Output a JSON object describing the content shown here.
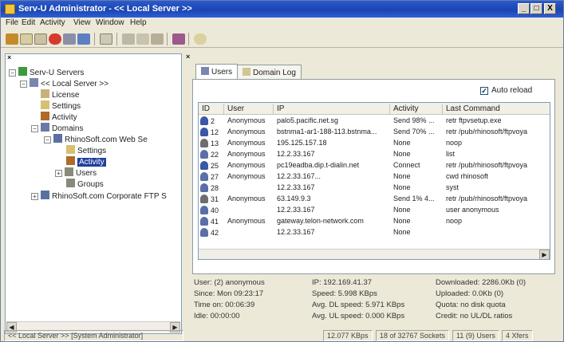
{
  "window": {
    "title": "Serv-U Administrator - << Local Server >>",
    "controls": [
      "_",
      "□",
      "X"
    ]
  },
  "menu": [
    "File",
    "Edit",
    "Activity",
    "View",
    "Window",
    "Help"
  ],
  "tree": {
    "root": "Serv-U Servers",
    "local_server": "<< Local Server >>",
    "license": "License",
    "settings": "Settings",
    "activity": "Activity",
    "domains": "Domains",
    "domain": "RhinoSoft.com Web Se",
    "domain_settings": "Settings",
    "domain_activity": "Activity",
    "users": "Users",
    "groups": "Groups",
    "other_domain": "RhinoSoft.com Corporate FTP S"
  },
  "tabs": [
    {
      "label": "Users"
    },
    {
      "label": "Domain Log"
    }
  ],
  "auto_reload": {
    "label": "Auto reload",
    "checked": true
  },
  "grid": {
    "columns": [
      "ID",
      "User",
      "IP",
      "Activity",
      "Last Command"
    ],
    "rows": [
      {
        "id": "2",
        "user": "Anonymous",
        "ip": "palo5.pacific.net.sg",
        "activity": "Send 98% ...",
        "cmd": "retr ftpvsetup.exe",
        "icon": "transfer"
      },
      {
        "id": "12",
        "user": "Anonymous",
        "ip": "bstnma1-ar1-188-113.bstnma...",
        "activity": "Send 70% ...",
        "cmd": "retr /pub/rhinosoft/ftpvoya",
        "icon": "transfer"
      },
      {
        "id": "13",
        "user": "Anonymous",
        "ip": "195.125.157.18",
        "activity": "None",
        "cmd": "noop",
        "icon": "idle"
      },
      {
        "id": "22",
        "user": "Anonymous",
        "ip": "12.2.33.167",
        "activity": "None",
        "cmd": "list",
        "icon": "user"
      },
      {
        "id": "25",
        "user": "Anonymous",
        "ip": "pc19eadba.dip.t-dialin.net",
        "activity": "Connect",
        "cmd": "retr /pub/rhinosoft/ftpvoya",
        "icon": "transfer"
      },
      {
        "id": "27",
        "user": "Anonymous",
        "ip": "12.2.33.167...",
        "activity": "None",
        "cmd": "cwd rhinosoft",
        "icon": "user"
      },
      {
        "id": "28",
        "user": "",
        "ip": "12.2.33.167",
        "activity": "None",
        "cmd": "syst",
        "icon": "user"
      },
      {
        "id": "31",
        "user": "Anonymous",
        "ip": "63.149.9.3",
        "activity": "Send 1% 4...",
        "cmd": "retr /pub/rhinosoft/ftpvoya",
        "icon": "idle"
      },
      {
        "id": "40",
        "user": "",
        "ip": "12.2.33.167",
        "activity": "None",
        "cmd": "user anonymous",
        "icon": "user"
      },
      {
        "id": "41",
        "user": "Anonymous",
        "ip": "gateway.telon-network.com",
        "activity": "None",
        "cmd": "noop",
        "icon": "user"
      },
      {
        "id": "42",
        "user": "",
        "ip": "12.2.33.167",
        "activity": "None",
        "cmd": "",
        "icon": "user"
      }
    ]
  },
  "stats": {
    "user": "User: (2) anonymous",
    "since": "Since: Mon 09:23:17",
    "time_on": "Time on: 00:06:39",
    "idle": "Idle: 00:00:00",
    "ip": "IP: 192.169.41.37",
    "speed": "Speed: 5.998 KBps",
    "avg_dl": "Avg. DL speed: 5.971 KBps",
    "avg_ul": "Avg. UL speed: 0.000 KBps",
    "downloaded": "Downloaded: 2286.0Kb (0)",
    "uploaded": "Uploaded: 0.0Kb (0)",
    "quota": "Quota: no disk quota",
    "credit": "Credit: no UL/DL ratios"
  },
  "status": {
    "server": "<< Local Server >>",
    "role": "[System Administrator]",
    "speed": "12.077 KBps",
    "sockets": "18 of 32767 Sockets",
    "users": "11 (9) Users",
    "xfers": "4 Xfers"
  },
  "colors": {
    "title_bar": "#1b45b0",
    "selection": "#1f3f9e"
  }
}
